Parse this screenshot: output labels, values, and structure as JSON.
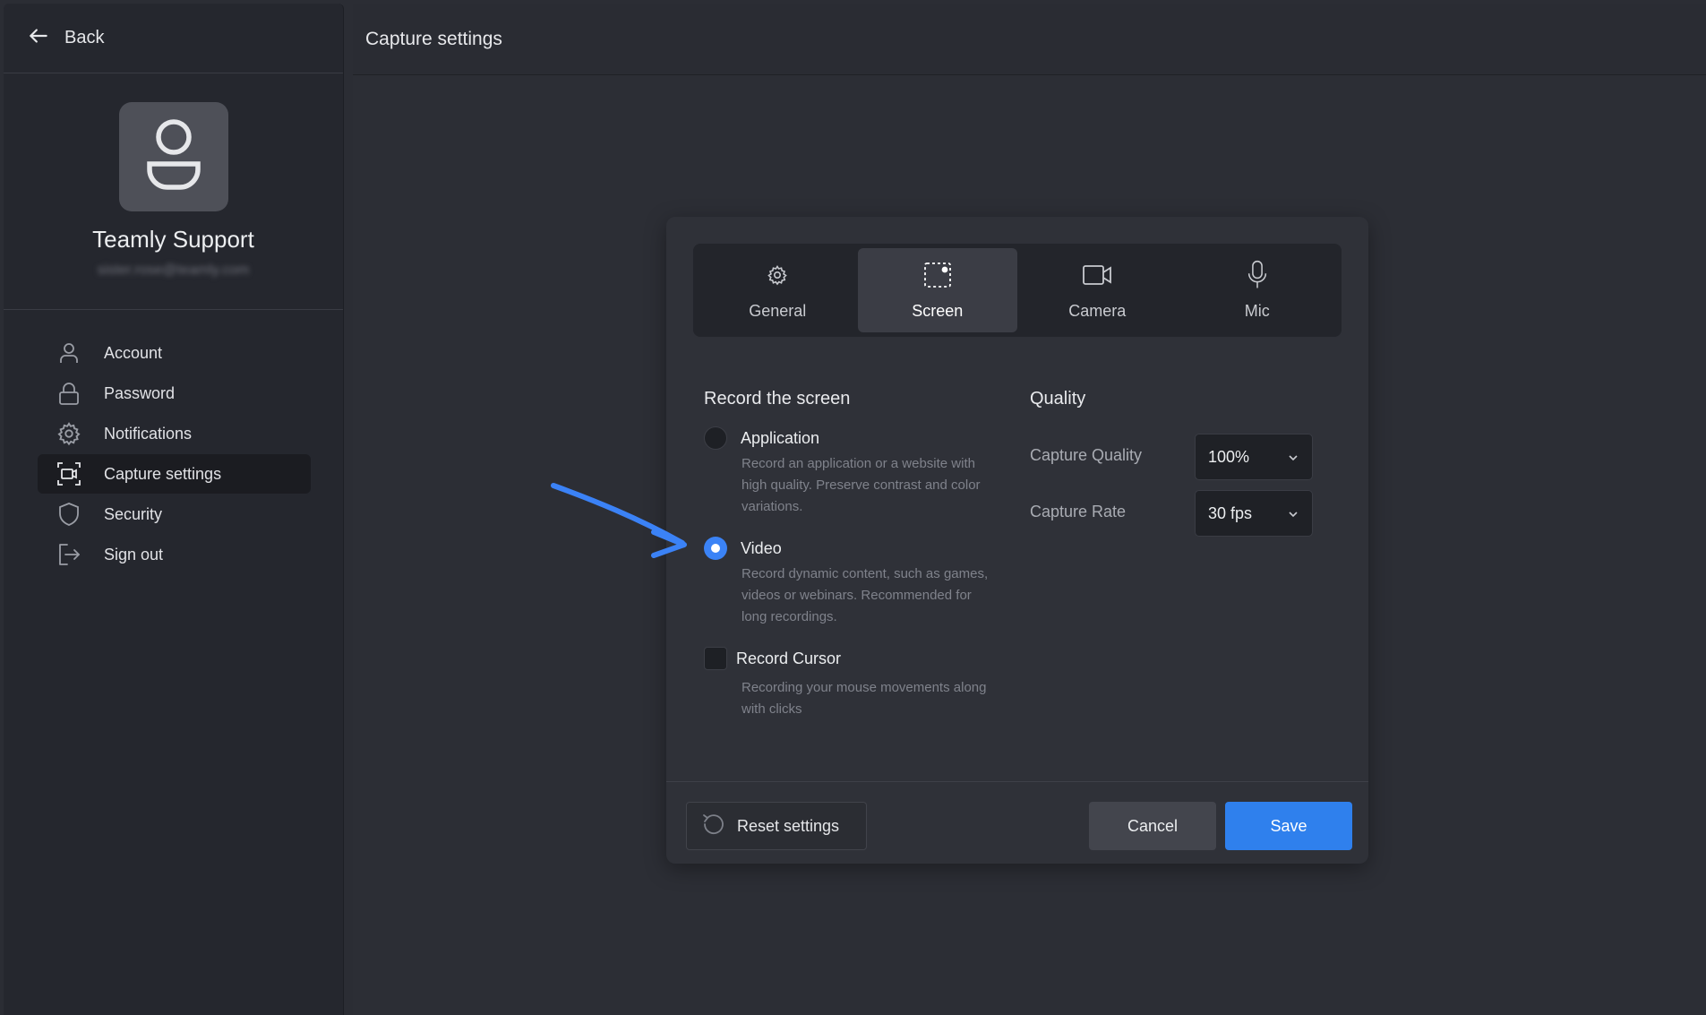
{
  "sidebar": {
    "back_label": "Back",
    "profile": {
      "name": "Teamly Support",
      "email": "sister.rose@teamly.com"
    },
    "items": [
      {
        "label": "Account",
        "icon": "user-icon"
      },
      {
        "label": "Password",
        "icon": "lock-icon"
      },
      {
        "label": "Notifications",
        "icon": "gear-icon"
      },
      {
        "label": "Capture settings",
        "icon": "capture-icon",
        "active": true
      },
      {
        "label": "Security",
        "icon": "shield-icon"
      },
      {
        "label": "Sign out",
        "icon": "sign-out-icon"
      }
    ]
  },
  "header": {
    "title": "Capture settings"
  },
  "dialog": {
    "tabs": [
      {
        "label": "General",
        "icon": "gear-icon"
      },
      {
        "label": "Screen",
        "icon": "screen-select-icon",
        "active": true
      },
      {
        "label": "Camera",
        "icon": "camera-icon"
      },
      {
        "label": "Mic",
        "icon": "microphone-icon"
      }
    ],
    "record_section": {
      "title": "Record the screen",
      "options": [
        {
          "label": "Application",
          "desc": "Record an application or a website with high quality. Preserve contrast and color variations.",
          "checked": false
        },
        {
          "label": "Video",
          "desc": "Record dynamic content, such as games, videos or webinars. Recommended for long recordings.",
          "checked": true
        }
      ],
      "cursor": {
        "label": "Record Cursor",
        "desc": "Recording your mouse movements along with clicks",
        "checked": false
      }
    },
    "quality_section": {
      "title": "Quality",
      "capture_quality_label": "Capture Quality",
      "capture_quality_value": "100%",
      "capture_rate_label": "Capture Rate",
      "capture_rate_value": "30 fps"
    },
    "footer": {
      "reset_label": "Reset settings",
      "cancel_label": "Cancel",
      "save_label": "Save"
    }
  },
  "colors": {
    "accent": "#2f80ed",
    "radio_checked": "#3b83f6",
    "arrow": "#3b82f6",
    "background": "#2b2d34"
  }
}
